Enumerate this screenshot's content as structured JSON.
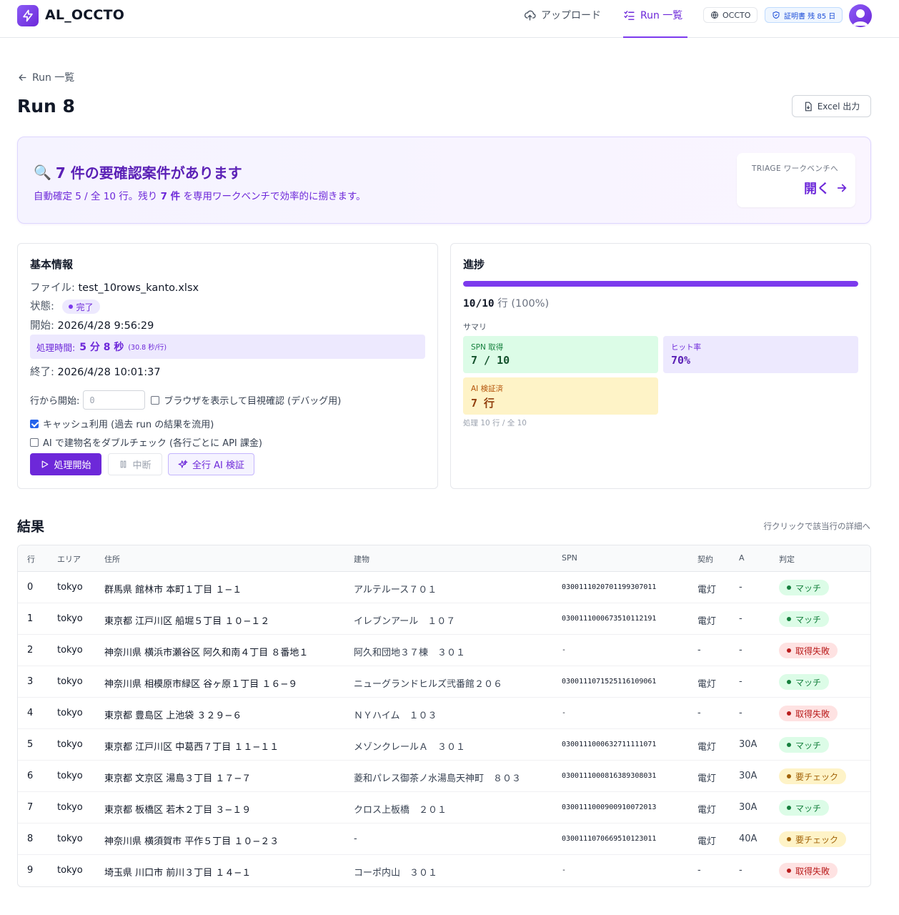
{
  "app": {
    "name": "AL_OCCTO"
  },
  "nav": {
    "upload": "アップロード",
    "runs": "Run 一覧",
    "occto": "OCCTO",
    "cert": "証明書 残 85 日"
  },
  "back": {
    "label": "Run 一覧"
  },
  "page": {
    "title": "Run 8",
    "excel": "Excel 出力"
  },
  "alert": {
    "icon": "🔍",
    "title": "7 件の要確認案件があります",
    "sub_pre": "自動確定 5 / 全 10 行。残り ",
    "sub_bold": "7 件",
    "sub_post": " を専用ワークベンチで効率的に捌きます。",
    "triage_label": "TRIAGE ワークベンチへ",
    "triage_open": "開く"
  },
  "basic": {
    "heading": "基本情報",
    "file_label": "ファイル: ",
    "file": "test_10rows_kanto.xlsx",
    "status_label": "状態: ",
    "status": "完了",
    "start_label": "開始: ",
    "start": "2026/4/28 9:56:29",
    "time_label": "処理時間:",
    "time": "5 分 8 秒",
    "time_per": "(30.8 秒/行)",
    "end_label": "終了: ",
    "end": "2026/4/28 10:01:37",
    "start_row_label": "行から開始:",
    "start_row_placeholder": "0",
    "opt_browser": "ブラウザを表示して目視確認 (デバッグ用)",
    "opt_cache": "キャッシュ利用 (過去 run の結果を流用)",
    "opt_ai": "AI で建物名をダブルチェック (各行ごとに API 課金)",
    "btn_start": "処理開始",
    "btn_stop": "中断",
    "btn_ai": "全行 AI 検証"
  },
  "progress": {
    "heading": "進捗",
    "fraction": 1.0,
    "count": "10/10",
    "unit": " 行 ",
    "pct": "(100%)",
    "summary": "サマリ",
    "spn_label": "SPN 取得",
    "spn_value": "7 / 10",
    "hit_label": "ヒット率",
    "hit_value": "70%",
    "ai_label": "AI 検証済",
    "ai_value": "7 行",
    "note": "処理 10 行 / 全 10"
  },
  "results": {
    "title": "結果",
    "hint": "行クリックで該当行の詳細へ",
    "columns": [
      "行",
      "エリア",
      "住所",
      "建物",
      "SPN",
      "契約",
      "A",
      "判定"
    ],
    "rows": [
      {
        "n": "0",
        "area": "tokyo",
        "addr": "群馬県 館林市 本町１丁目 １−１",
        "bldg": "アルテルース７０１",
        "spn": "0300111020701199307011",
        "contract": "電灯",
        "a": "-",
        "status": "マッチ",
        "kind": "match"
      },
      {
        "n": "1",
        "area": "tokyo",
        "addr": "東京都 江戸川区 船堀５丁目 １０−１２",
        "bldg": "イレブンアール　１０７",
        "spn": "0300111000673510112191",
        "contract": "電灯",
        "a": "-",
        "status": "マッチ",
        "kind": "match"
      },
      {
        "n": "2",
        "area": "tokyo",
        "addr": "神奈川県 横浜市瀬谷区 阿久和南４丁目 ８番地１",
        "bldg": "阿久和団地３７棟　３０１",
        "spn": "-",
        "contract": "-",
        "a": "-",
        "status": "取得失敗",
        "kind": "fail"
      },
      {
        "n": "3",
        "area": "tokyo",
        "addr": "神奈川県 相模原市緑区 谷ヶ原１丁目 １６−９",
        "bldg": "ニューグランドヒルズ弐番館２０６",
        "spn": "0300111071525116109061",
        "contract": "電灯",
        "a": "-",
        "status": "マッチ",
        "kind": "match"
      },
      {
        "n": "4",
        "area": "tokyo",
        "addr": "東京都 豊島区 上池袋 ３２９−６",
        "bldg": "ＮＹハイム　１０３",
        "spn": "-",
        "contract": "-",
        "a": "-",
        "status": "取得失敗",
        "kind": "fail"
      },
      {
        "n": "5",
        "area": "tokyo",
        "addr": "東京都 江戸川区 中葛西７丁目 １１−１１",
        "bldg": "メゾンクレールＡ　３０１",
        "spn": "0300111000632711111071",
        "contract": "電灯",
        "a": "30A",
        "status": "マッチ",
        "kind": "match"
      },
      {
        "n": "6",
        "area": "tokyo",
        "addr": "東京都 文京区 湯島３丁目 １７−７",
        "bldg": "菱和パレス御茶ノ水湯島天神町　８０３",
        "spn": "0300111000816389308031",
        "contract": "電灯",
        "a": "30A",
        "status": "要チェック",
        "kind": "check"
      },
      {
        "n": "7",
        "area": "tokyo",
        "addr": "東京都 板橋区 若木２丁目 ３−１９",
        "bldg": "クロス上板橋　２０１",
        "spn": "0300111000900910072013",
        "contract": "電灯",
        "a": "30A",
        "status": "マッチ",
        "kind": "match"
      },
      {
        "n": "8",
        "area": "tokyo",
        "addr": "神奈川県 横須賀市 平作５丁目 １０−２３",
        "bldg": "-",
        "spn": "0300111070669510123011",
        "contract": "電灯",
        "a": "40A",
        "status": "要チェック",
        "kind": "check"
      },
      {
        "n": "9",
        "area": "tokyo",
        "addr": "埼玉県 川口市 前川３丁目 １４−１",
        "bldg": "コーポ内山　３０１",
        "spn": "-",
        "contract": "-",
        "a": "-",
        "status": "取得失敗",
        "kind": "fail"
      }
    ]
  },
  "colors": {
    "accent": "#6d28d9",
    "match": "#15803d",
    "fail": "#b91c1c",
    "check": "#a16207"
  }
}
